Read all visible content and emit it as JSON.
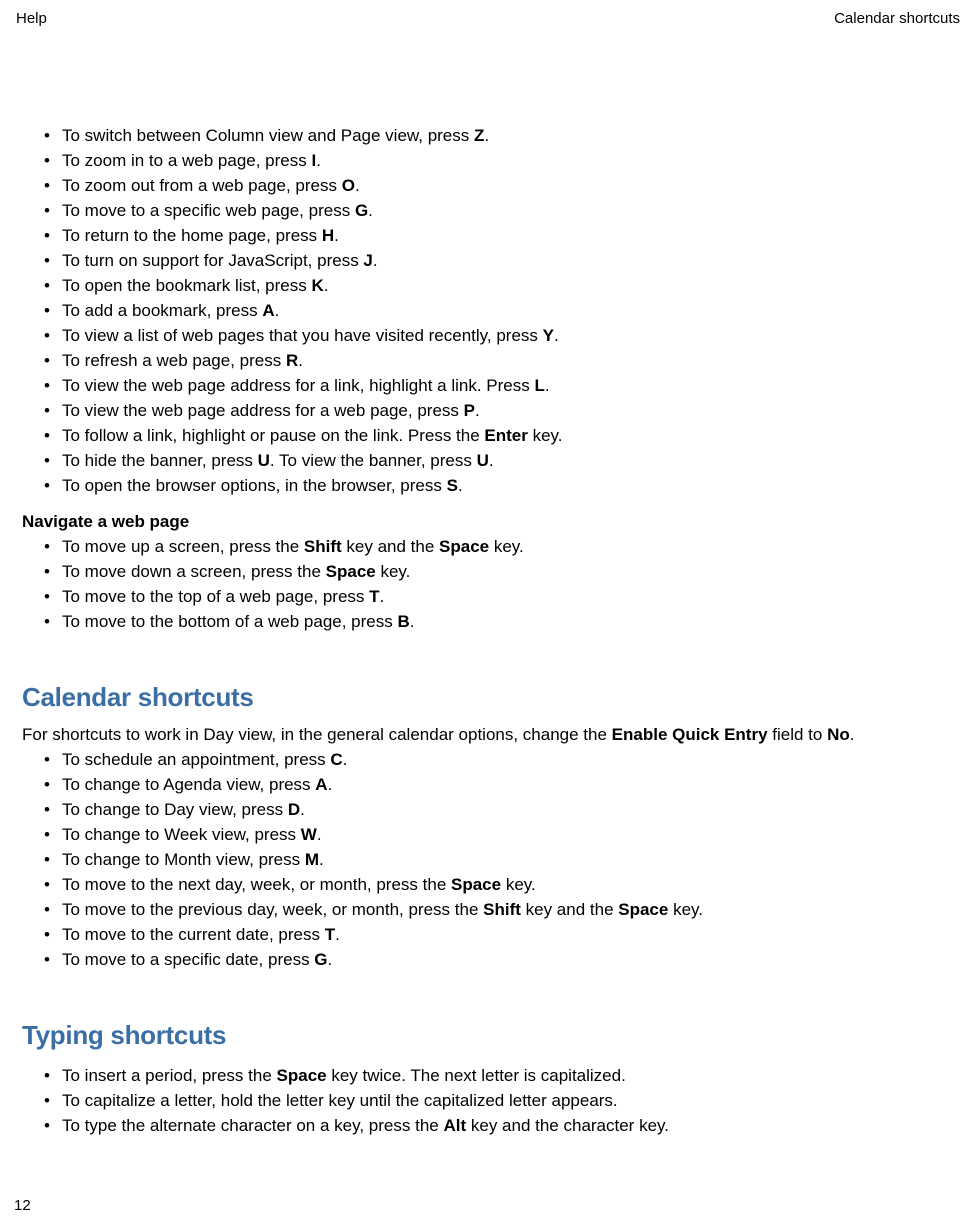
{
  "header": {
    "left": "Help",
    "right": "Calendar shortcuts"
  },
  "page_number": "12",
  "browser_shortcuts": [
    {
      "pre": "To switch between Column view and Page view, press ",
      "key": "Z",
      "post": "."
    },
    {
      "pre": "To zoom in to a web page, press ",
      "key": "I",
      "post": "."
    },
    {
      "pre": "To zoom out from a web page, press ",
      "key": "O",
      "post": "."
    },
    {
      "pre": "To move to a specific web page, press ",
      "key": "G",
      "post": "."
    },
    {
      "pre": "To return to the home page, press ",
      "key": "H",
      "post": "."
    },
    {
      "pre": "To turn on support for JavaScript, press ",
      "key": "J",
      "post": "."
    },
    {
      "pre": "To open the bookmark list, press ",
      "key": "K",
      "post": "."
    },
    {
      "pre": "To add a bookmark, press ",
      "key": "A",
      "post": "."
    },
    {
      "pre": "To view a list of web pages that you have visited recently, press ",
      "key": "Y",
      "post": "."
    },
    {
      "pre": "To refresh a web page, press ",
      "key": "R",
      "post": "."
    },
    {
      "pre": "To view the web page address for a link, highlight a link. Press ",
      "key": "L",
      "post": "."
    },
    {
      "pre": "To view the web page address for a web page, press ",
      "key": "P",
      "post": "."
    },
    {
      "pre": "To follow a link, highlight or pause on the link. Press the ",
      "key": "Enter",
      "post": " key."
    },
    {
      "pre": "To hide the banner, press ",
      "key": "U",
      "mid": ". To view the banner, press ",
      "key2": "U",
      "post": "."
    },
    {
      "pre": "To open the browser options, in the browser, press ",
      "key": "S",
      "post": "."
    }
  ],
  "nav_subhead": "Navigate a web page",
  "nav_items": [
    {
      "pre": "To move up a screen, press the ",
      "key": "Shift",
      "mid": " key and the ",
      "key2": "Space",
      "post": " key."
    },
    {
      "pre": "To move down a screen, press the ",
      "key": "Space",
      "post": " key."
    },
    {
      "pre": "To move to the top of a web page, press ",
      "key": "T",
      "post": "."
    },
    {
      "pre": "To move to the bottom of a web page, press ",
      "key": "B",
      "post": "."
    }
  ],
  "cal_heading": "Calendar shortcuts",
  "cal_lead": {
    "pre": "For shortcuts to work in Day view, in the general calendar options, change the ",
    "b1": "Enable Quick Entry",
    "mid": " field to ",
    "b2": "No",
    "post": "."
  },
  "cal_items": [
    {
      "pre": "To schedule an appointment, press ",
      "key": "C",
      "post": "."
    },
    {
      "pre": "To change to Agenda view, press ",
      "key": "A",
      "post": "."
    },
    {
      "pre": "To change to Day view, press ",
      "key": "D",
      "post": "."
    },
    {
      "pre": "To change to Week view, press ",
      "key": "W",
      "post": "."
    },
    {
      "pre": "To change to Month view, press ",
      "key": "M",
      "post": "."
    },
    {
      "pre": "To move to the next day, week, or month, press the ",
      "key": "Space",
      "post": " key."
    },
    {
      "pre": "To move to the previous day, week, or month, press the ",
      "key": "Shift",
      "mid": " key and the ",
      "key2": "Space",
      "post": " key."
    },
    {
      "pre": "To move to the current date, press ",
      "key": "T",
      "post": "."
    },
    {
      "pre": "To move to a specific date, press ",
      "key": "G",
      "post": "."
    }
  ],
  "typ_heading": "Typing shortcuts",
  "typ_items": [
    {
      "pre": "To insert a period, press the ",
      "key": "Space",
      "post": " key twice. The next letter is capitalized."
    },
    {
      "pre": "To capitalize a letter, hold the letter key until the capitalized letter appears."
    },
    {
      "pre": "To type the alternate character on a key, press the ",
      "key": "Alt",
      "post": " key and the character key."
    }
  ]
}
